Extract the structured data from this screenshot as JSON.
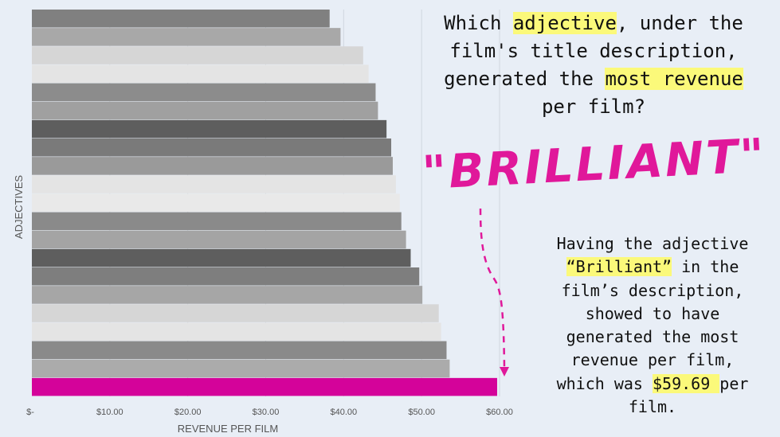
{
  "chart_data": {
    "type": "bar",
    "orientation": "horizontal",
    "xlabel": "REVENUE PER FILM",
    "ylabel": "ADJECTIVES",
    "xlim": [
      0,
      60
    ],
    "xticks": [
      "$-",
      "$10.00",
      "$20.00",
      "$30.00",
      "$40.00",
      "$50.00",
      "$60.00"
    ],
    "values": [
      38.2,
      39.6,
      42.5,
      43.2,
      44.1,
      44.4,
      45.5,
      46.1,
      46.3,
      46.7,
      47.2,
      47.4,
      48.0,
      48.6,
      49.7,
      50.1,
      52.2,
      52.5,
      53.2,
      53.6,
      59.69
    ],
    "highlight_index": 20,
    "grid": true
  },
  "colors": {
    "background": "#e8eef6",
    "highlight": "#d4039a",
    "accent_text": "#e0189a",
    "marker": "#fbf97a",
    "bar_shades": [
      "#808080",
      "#a8a8a8",
      "#d6d6d6",
      "#e4e4e4",
      "#8c8c8c",
      "#a0a0a0",
      "#5e5e5e",
      "#7a7a7a",
      "#9a9a9a",
      "#e4e4e4",
      "#e9e9e9",
      "#8a8a8a",
      "#a4a4a4",
      "#5e5e5e",
      "#7e7e7e",
      "#a6a6a6",
      "#d6d6d6",
      "#e4e4e4",
      "#8a8a8a",
      "#ababab"
    ]
  },
  "question": {
    "line1a": "Which ",
    "line1hl": "adjective",
    "line1b": ", under the",
    "line2": "film's title description,",
    "line3a": "generated the ",
    "line3hl": "most revenue",
    "line4": "per film?"
  },
  "headline": "\"BRILLIANT\"",
  "answer": {
    "l1": "Having the adjective",
    "l2hl": "“Brilliant”",
    "l2b": " in the",
    "l3": "film’s description,",
    "l4": "showed to have",
    "l5": "generated the most",
    "l6": "revenue per film,",
    "l7a": "which was ",
    "l7hl": "$59.69 ",
    "l7b": "per",
    "l8": "film."
  }
}
